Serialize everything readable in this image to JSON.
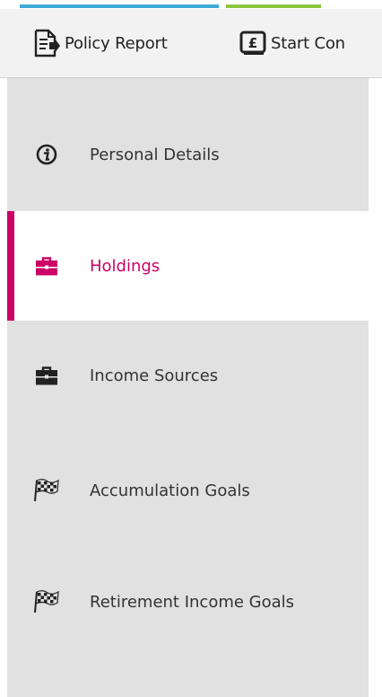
{
  "colors": {
    "accent_blue": "#3fa9d6",
    "accent_green": "#8cc63f",
    "active": "#cc0066",
    "sidebar_bg": "#e1e1e1",
    "toolbar_bg": "#f2f2f2"
  },
  "toolbar": {
    "policy_report": {
      "label": "Policy Report",
      "icon": "document-arrow-icon"
    },
    "start_con": {
      "label": "Start Con",
      "icon": "pound-box-icon"
    }
  },
  "sidebar": {
    "items": [
      {
        "label": "Personal Details",
        "icon": "info-icon",
        "active": false
      },
      {
        "label": "Holdings",
        "icon": "briefcase-icon",
        "active": true
      },
      {
        "label": "Income Sources",
        "icon": "briefcase-icon",
        "active": false
      },
      {
        "label": "Accumulation Goals",
        "icon": "checkered-flag-icon",
        "active": false
      },
      {
        "label": "Retirement Income Goals",
        "icon": "checkered-flag-icon",
        "active": false
      }
    ]
  }
}
